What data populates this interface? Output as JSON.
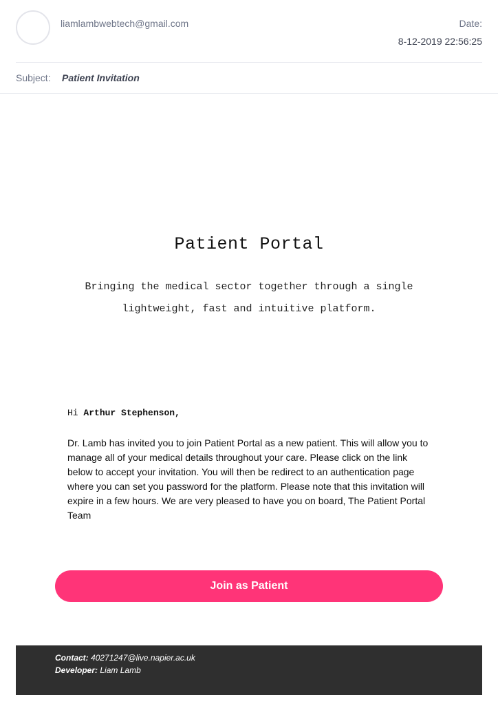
{
  "email": {
    "from": "liamlambwebtech@gmail.com",
    "date_label": "Date:",
    "date_value": "8-12-2019 22:56:25",
    "subject_label": "Subject:",
    "subject_value": "Patient Invitation"
  },
  "hero": {
    "title": "Patient Portal",
    "subtitle": "Bringing the medical sector together through a single lightweight, fast and intuitive platform."
  },
  "message": {
    "greeting_prefix": "Hi",
    "patient_name": "Arthur Stephenson,",
    "body": "Dr. Lamb has invited you to join Patient Portal as a new patient. This will allow you to manage all of your medical details throughout your care. Please click on the link below to accept your invitation. You will then be redirect to an authentication page where you can set you password for the platform. Please note that this invitation will expire in a few hours. We are very pleased to have you on board, The Patient Portal Team"
  },
  "cta": {
    "label": "Join as Patient",
    "color": "#ff3478"
  },
  "footer": {
    "contact_label": "Contact:",
    "contact_value": "40271247@live.napier.ac.uk",
    "developer_label": "Developer:",
    "developer_value": "Liam Lamb"
  }
}
